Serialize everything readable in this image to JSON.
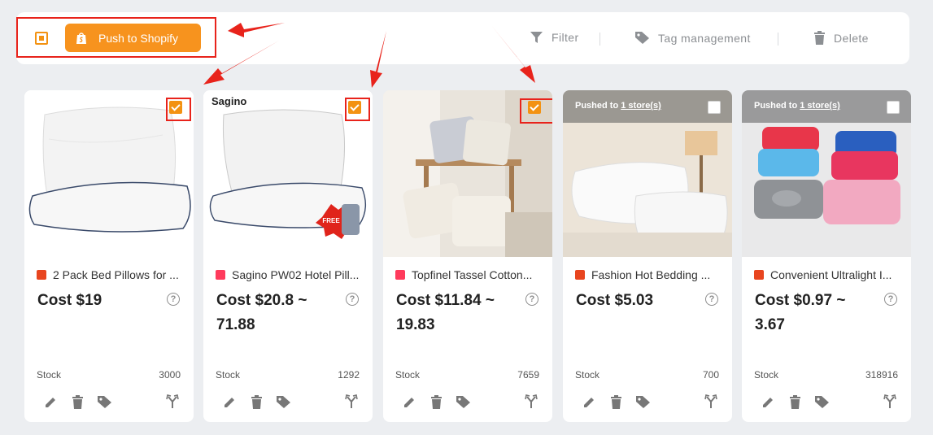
{
  "toolbar": {
    "push_label": "Push to Shopify",
    "filter_label": "Filter",
    "tag_label": "Tag management",
    "delete_label": "Delete"
  },
  "icons": {
    "checkbox": "checkbox-icon",
    "shopify": "shopify-bag-icon",
    "filter": "filter-icon",
    "tag": "tag-icon",
    "delete": "trash-icon",
    "edit": "pencil-icon",
    "fork": "split-icon",
    "help": "question-circle-icon"
  },
  "colors": {
    "accent": "#f7931e",
    "highlight": "#e8231b",
    "aliexpress": "#e8451f",
    "other_source": "#ff3b5c"
  },
  "cards": [
    {
      "title": "2 Pack Bed Pillows for ...",
      "cost": "Cost $19",
      "stock_label": "Stock",
      "stock": "3000",
      "checked": true,
      "pushed": false
    },
    {
      "title": "Sagino PW02 Hotel Pill...",
      "cost": "Cost $20.8 ~ 71.88",
      "stock_label": "Stock",
      "stock": "1292",
      "checked": true,
      "pushed": false,
      "brand": "Sagino",
      "badge_text": "FREE"
    },
    {
      "title": "Topfinel Tassel Cotton...",
      "cost": "Cost $11.84 ~ 19.83",
      "stock_label": "Stock",
      "stock": "7659",
      "checked": true,
      "pushed": false
    },
    {
      "title": "Fashion Hot Bedding ...",
      "cost": "Cost $5.03",
      "stock_label": "Stock",
      "stock": "700",
      "checked": false,
      "pushed": true,
      "pushed_prefix": "Pushed to ",
      "pushed_link": "1 store(s)"
    },
    {
      "title": "Convenient Ultralight I...",
      "cost": "Cost $0.97 ~ 3.67",
      "stock_label": "Stock",
      "stock": "318916",
      "checked": false,
      "pushed": true,
      "pushed_prefix": "Pushed to ",
      "pushed_link": "1 store(s)"
    }
  ]
}
